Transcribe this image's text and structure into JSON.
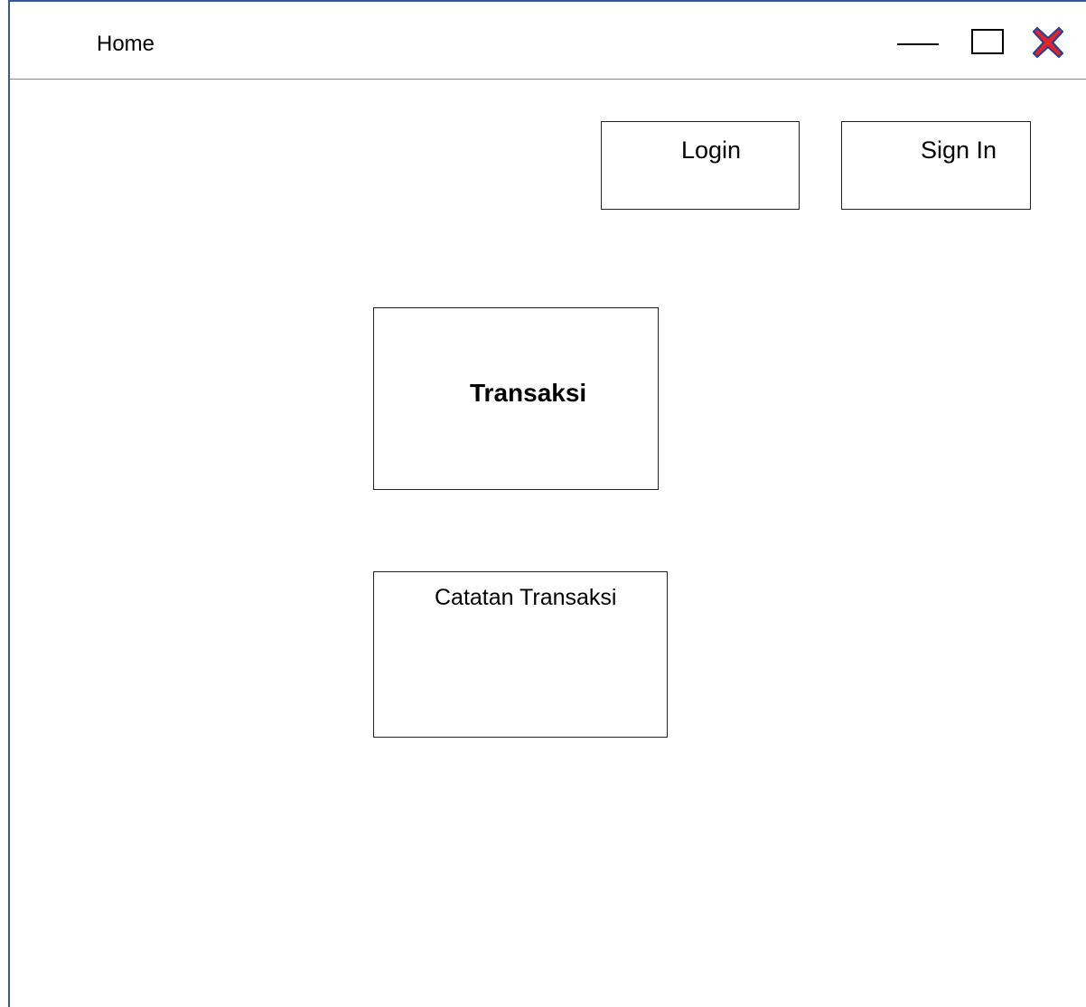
{
  "window": {
    "title": "Home",
    "controls": {
      "minimize_icon": "minimize-icon",
      "maximize_icon": "maximize-icon",
      "close_icon": "close-icon",
      "close_color": "#e0262b",
      "close_outline": "#2e3f8f"
    }
  },
  "header": {
    "login_label": "Login",
    "signin_label": "Sign In"
  },
  "main": {
    "transaksi_label": "Transaksi",
    "catatan_label": "Catatan Transaksi"
  },
  "colors": {
    "frame": "#3a5696",
    "titlebar_divider": "#6f8dc4"
  }
}
